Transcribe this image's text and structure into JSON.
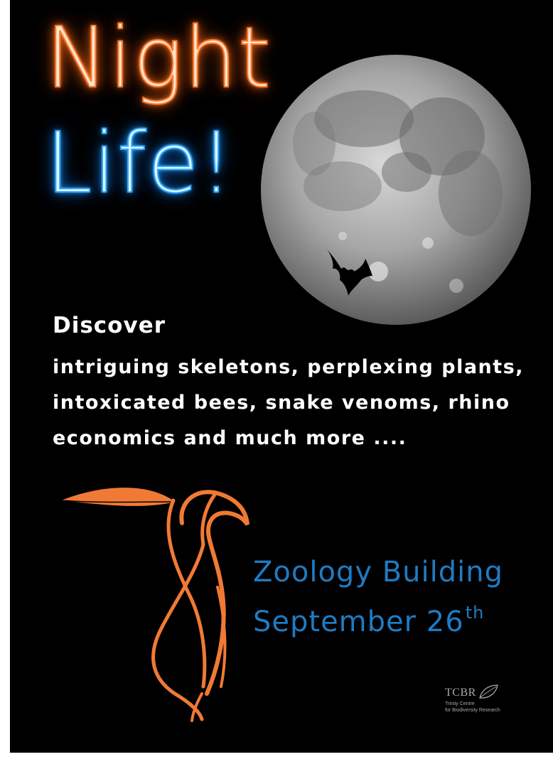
{
  "title": {
    "line1": "Night",
    "line2": "Life!"
  },
  "colors": {
    "neon_orange": "#ff7a2e",
    "neon_blue": "#2fa8ff",
    "logo_orange": "#f07a35",
    "venue_blue": "#1f7bc4",
    "background": "#000000"
  },
  "body": {
    "heading": "Discover",
    "text": "intriguing skeletons, perplexing plants, intoxicated bees, snake venoms, rhino economics and much more ...."
  },
  "event": {
    "venue": "Zoology Building",
    "date": "September 26",
    "date_suffix": "th"
  },
  "organizer": {
    "mark": "TCBR",
    "line1": "Trinity Centre",
    "line2": "for Biodiversity Research"
  },
  "icons": [
    "moon-image",
    "bat-icon",
    "bird-leaf-logo",
    "leaf-icon"
  ]
}
